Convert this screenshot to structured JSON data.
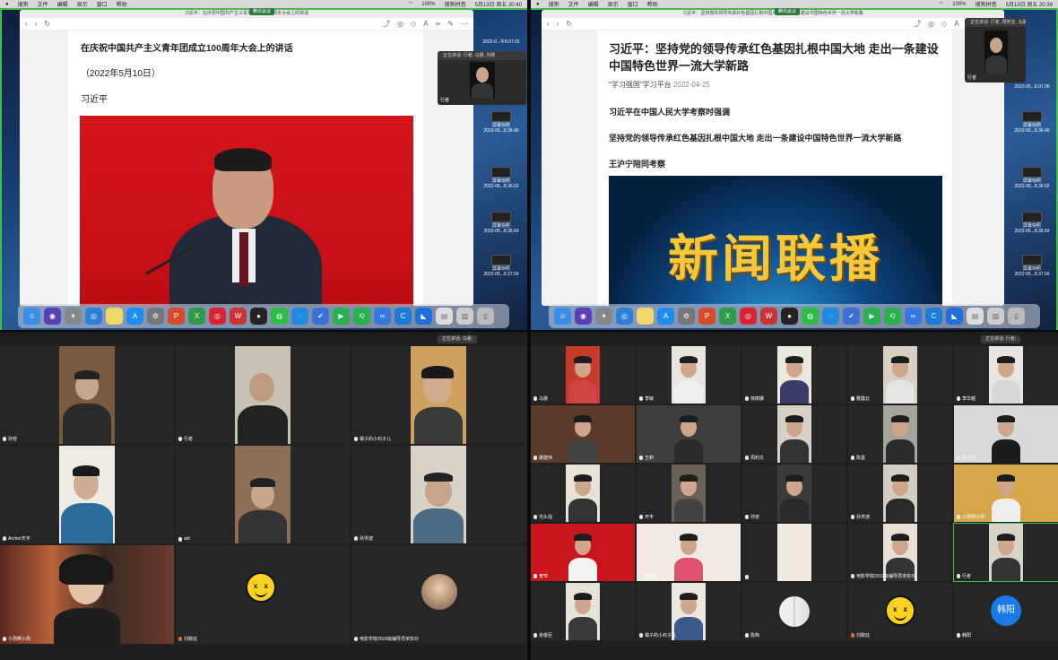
{
  "q1": {
    "menubar": {
      "apple": "",
      "items": [
        "搜狗",
        "文件",
        "编辑",
        "显示",
        "窗口",
        "帮助"
      ],
      "clock": "5月13日 周五 20:40",
      "battery": "100%",
      "ime": "搜狗拼音"
    },
    "window_title": "习近平：在庆祝中国共产主义青年团成立100周年大会上的讲话",
    "share_label": "腾讯会议",
    "article": {
      "title": "在庆祝中国共产主义青年团成立100周年大会上的讲话",
      "date": "（2022年5月10日）",
      "author": "习近平"
    },
    "speaker": {
      "status": "正在讲话: 行者, 马晨, 刘致",
      "name": "行者"
    },
    "side_files": [
      {
        "line1": "",
        "line2": "2022-0...午8.07.01"
      },
      {
        "line1": "屏幕快照",
        "line2": "2022-05...8.36.45"
      },
      {
        "line1": "屏幕快照",
        "line2": "2022-05...8.36.52"
      },
      {
        "line1": "屏幕快照",
        "line2": "2022-05...8.36.54"
      },
      {
        "line1": "屏幕快照",
        "line2": "2022-05...8.37.04"
      }
    ]
  },
  "q2": {
    "menubar": {
      "apple": "",
      "items": [
        "搜狗",
        "文件",
        "编辑",
        "显示",
        "窗口",
        "帮助"
      ],
      "clock": "5月13日 周五 20:39",
      "battery": "100%",
      "ime": "搜狗拼音"
    },
    "window_title": "习近平：坚持党的领导传承红色基因扎根中国大地 走出一条建设中国特色世界一流大学新路",
    "share_label": "腾讯会议",
    "article": {
      "title": "习近平：坚持党的领导传承红色基因扎根中国大地 走出一条建设中国特色世界一流大学新路",
      "source": "\"学习强国\"学习平台",
      "date": "2022-04-25",
      "lead1": "习近平在中国人民大学考察时强调",
      "lead2": "坚持党的领导传承红色基因扎根中国大地 走出一条建设中国特色世界一流大学新路",
      "lead3": "王沪宁陪同考察",
      "banner": "新闻联播"
    },
    "speaker": {
      "status": "正在讲话: 行者, 周阿宝, 马晨...",
      "name": "行者"
    },
    "side_files": [
      {
        "line1": "",
        "line2": "2022-05...8.07.06"
      },
      {
        "line1": "屏幕快照",
        "line2": "2022-05...8.36.45"
      },
      {
        "line1": "屏幕快照",
        "line2": "2022-05...8.36.52"
      },
      {
        "line1": "屏幕快照",
        "line2": "2022-05...8.36.54"
      },
      {
        "line1": "屏幕快照",
        "line2": "2022-05...8.37.04"
      }
    ]
  },
  "q3": {
    "speaking": "正在讲话: 马晨;",
    "tiles": [
      "孙容",
      "行者",
      "橘子的小石子儿",
      "Archer天宇",
      "aid",
      "孙洪波",
      "小周啊小周",
      "刘致廷",
      "电影学院2019级辅导员宋玖玲"
    ]
  },
  "q4": {
    "speaking": "正在讲话: 行者;",
    "tiles": [
      "马晨",
      "李敏",
      "徐丽娜",
      "雅露云",
      "李华越",
      "康建伟",
      "王莉",
      "周利文",
      "陈墨",
      "廖力伟",
      "光头强",
      "开丰",
      "孙容",
      "孙洪波",
      "小周啊小周",
      "宽窄",
      "周珂宝",
      "",
      "电影学院2019级辅导员宋玖玲",
      "行者",
      "张俊臣",
      "橘子的小石子儿",
      "陈陶",
      "刘致廷",
      "韩阳"
    ],
    "avatar_text": "韩阳"
  }
}
